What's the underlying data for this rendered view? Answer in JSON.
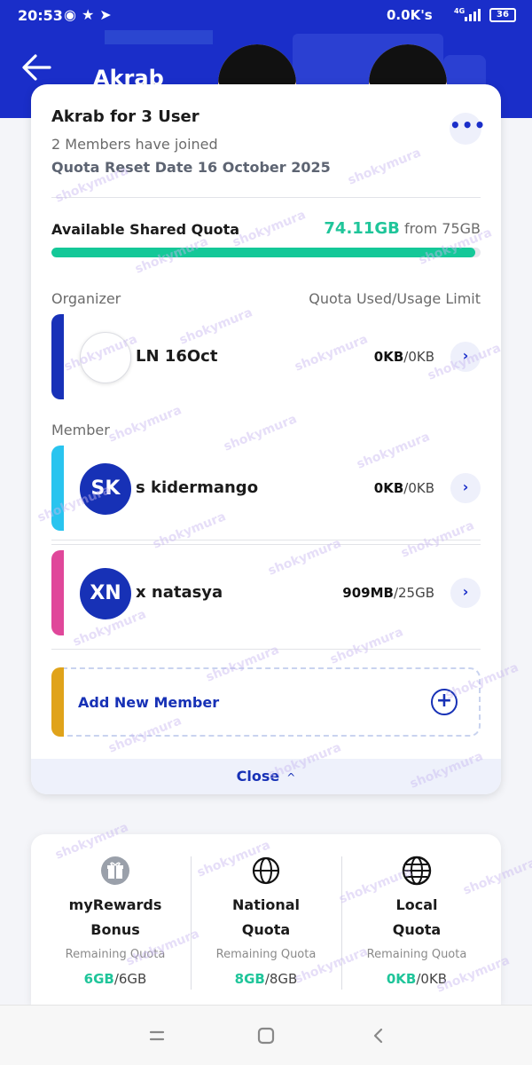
{
  "status_bar": {
    "time": "20:53",
    "speed": "0.0K's",
    "network": "4G",
    "battery": "36"
  },
  "header": {
    "title": "Akrab",
    "back_icon": "arrow-left-icon",
    "color": "#1a2ec9"
  },
  "plan": {
    "name": "Akrab for 3 User",
    "members_joined": "2 Members have joined",
    "reset_date": "Quota Reset Date 16 October 2025",
    "more_icon": "more-horizontal-icon"
  },
  "shared_quota": {
    "label": "Available Shared Quota",
    "available": "74.11GB",
    "from_text": "from 75GB",
    "fraction": 0.988
  },
  "labels": {
    "organizer": "Organizer",
    "quota_column": "Quota Used/Usage Limit",
    "member": "Member"
  },
  "organizer": {
    "initials": "",
    "name": "LN 16Oct",
    "used": "0KB",
    "limit": "/0KB",
    "stripe_color": "#1831b8"
  },
  "members": [
    {
      "initials": "SK",
      "name": "s kidermango",
      "used": "0KB",
      "limit": "/0KB",
      "stripe_color": "#29c4ef"
    },
    {
      "initials": "XN",
      "name": "x natasya",
      "used": "909MB",
      "limit": "/25GB",
      "stripe_color": "#e0479a"
    }
  ],
  "add_member": {
    "label": "Add New Member",
    "icon": "plus-circle-icon",
    "stripe_color": "#e0a31a"
  },
  "close": {
    "label": "Close",
    "caret": "^"
  },
  "quotas": [
    {
      "icon": "gift-icon",
      "title_line1": "myRewards",
      "title_line2": "Bonus",
      "sub": "Remaining Quota",
      "remaining": "6GB",
      "total": "/6GB"
    },
    {
      "icon": "globe-icon",
      "title_line1": "National",
      "title_line2": "Quota",
      "sub": "Remaining Quota",
      "remaining": "8GB",
      "total": "/8GB"
    },
    {
      "icon": "globe-icon",
      "title_line1": "Local",
      "title_line2": "Quota",
      "sub": "Remaining Quota",
      "remaining": "0KB",
      "total": "/0KB"
    }
  ],
  "navbar": {
    "recents_icon": "recents-icon",
    "home_icon": "home-icon",
    "back_icon": "back-icon"
  },
  "watermark": "shokymura",
  "accent": "#1731b6",
  "success": "#1fc59a"
}
